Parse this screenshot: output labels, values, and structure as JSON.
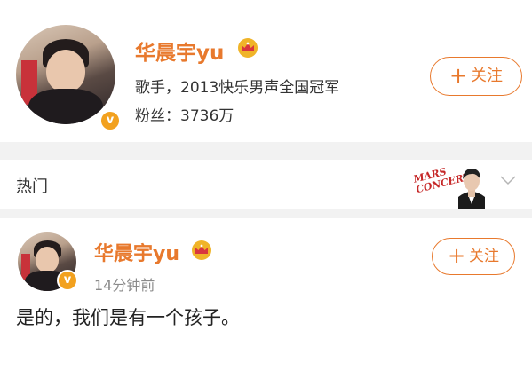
{
  "profile": {
    "name": "华晨宇yu",
    "bio": "歌手，2013快乐男声全国冠军",
    "followers_label": "粉丝：",
    "followers_value": "3736万",
    "verified_badge": "v",
    "follow_button": "关注",
    "plus": "+"
  },
  "hot_section": {
    "label": "热门",
    "promo_text": "MARS CONCERT"
  },
  "post": {
    "name": "华晨宇yu",
    "time": "14分钟前",
    "verified_badge": "v",
    "follow_button": "关注",
    "plus": "+",
    "body": "是的，我们是有一个孩子。"
  },
  "colors": {
    "accent_orange": "#e8792d",
    "crown_gold": "#f0b429",
    "crown_red": "#d9363e",
    "background": "#f2f2f2"
  },
  "icons": {
    "crown": "crown-icon",
    "verified": "verified-badge-icon",
    "chevron": "chevron-down-icon",
    "plus": "plus-icon"
  }
}
